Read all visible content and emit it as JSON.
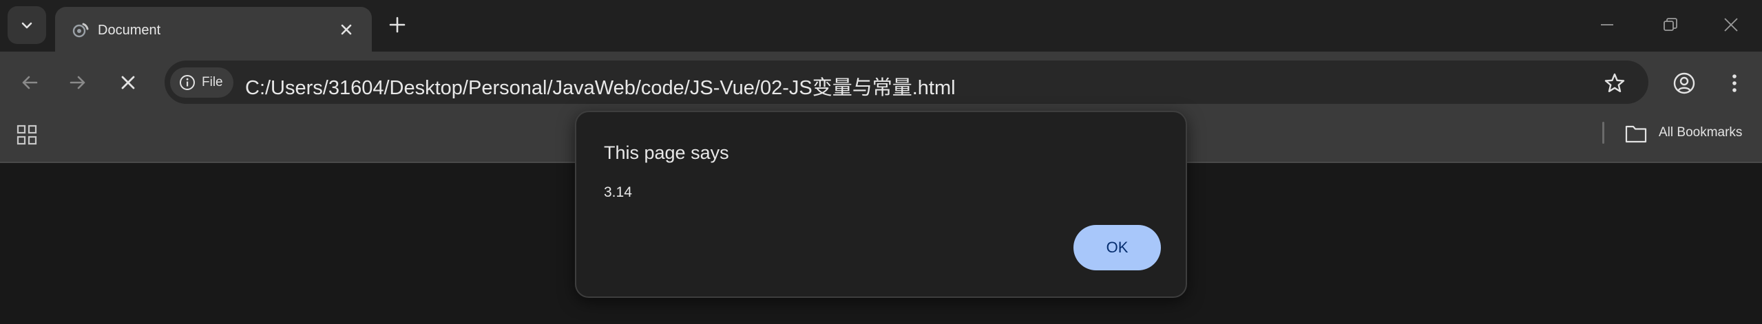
{
  "tabstrip": {
    "tab": {
      "title": "Document"
    }
  },
  "toolbar": {
    "site_chip_label": "File",
    "url": "C:/Users/31604/Desktop/Personal/JavaWeb/code/JS-Vue/02-JS变量与常量.html"
  },
  "bookmarks_bar": {
    "folder_label": "All Bookmarks"
  },
  "dialog": {
    "title": "This page says",
    "message": "3.14",
    "ok_label": "OK"
  },
  "colors": {
    "frame": "#202020",
    "toolbar": "#3b3b3b",
    "omnibox": "#282828",
    "page": "#181818",
    "ok_button": "#a8c7fa",
    "ok_text": "#062e6f"
  }
}
